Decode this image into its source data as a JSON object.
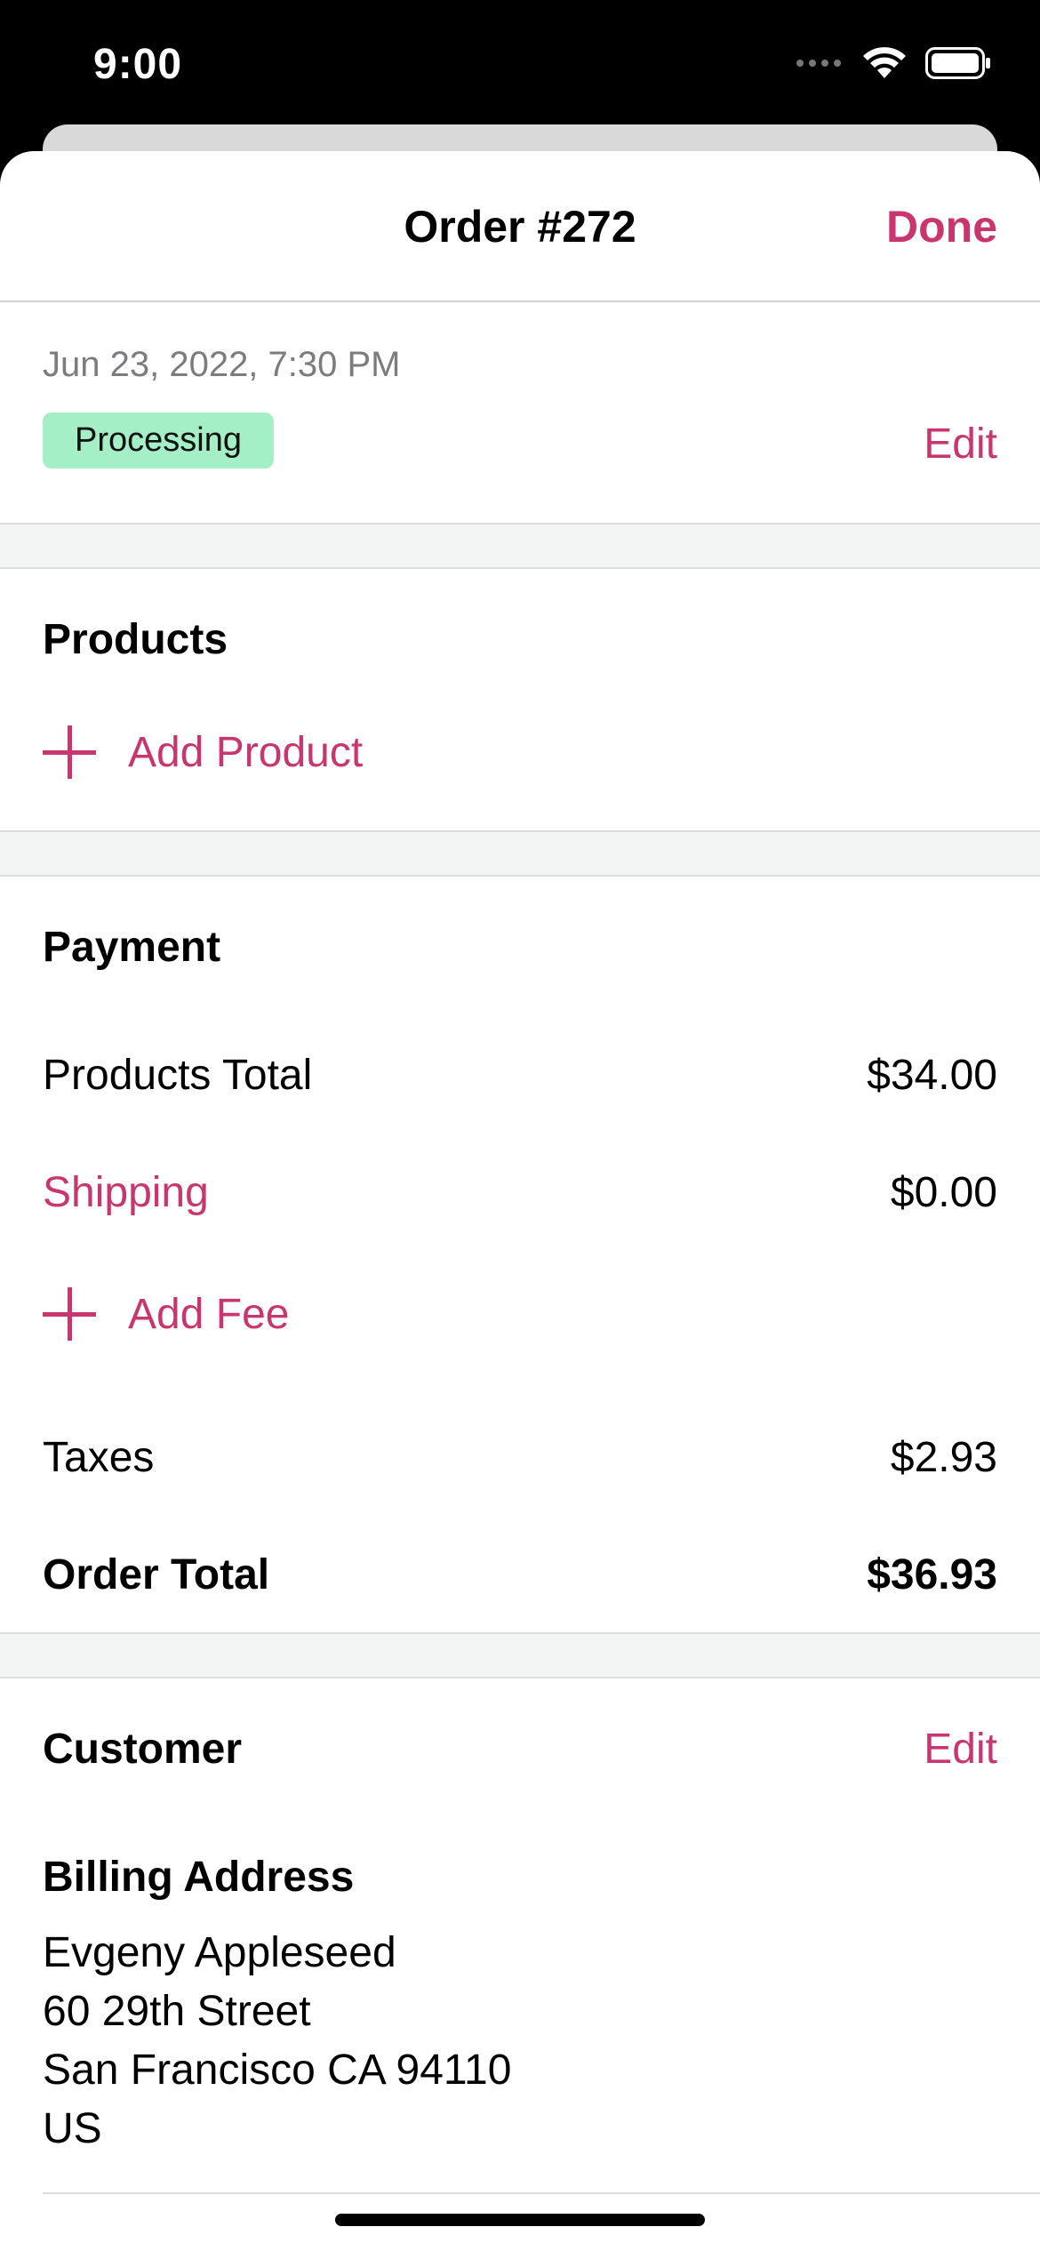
{
  "status_bar": {
    "time": "9:00"
  },
  "nav": {
    "title": "Order #272",
    "done": "Done"
  },
  "order": {
    "date": "Jun 23, 2022, 7:30 PM",
    "status": "Processing",
    "edit": "Edit"
  },
  "products": {
    "title": "Products",
    "add_product": "Add Product"
  },
  "payment": {
    "title": "Payment",
    "products_total_label": "Products Total",
    "products_total_value": "$34.00",
    "shipping_label": "Shipping",
    "shipping_value": "$0.00",
    "add_fee": "Add Fee",
    "taxes_label": "Taxes",
    "taxes_value": "$2.93",
    "order_total_label": "Order Total",
    "order_total_value": "$36.93"
  },
  "customer": {
    "title": "Customer",
    "edit": "Edit",
    "billing_title": "Billing Address",
    "billing_lines": [
      "Evgeny Appleseed",
      "60 29th Street",
      "San Francisco CA 94110",
      "US"
    ]
  },
  "colors": {
    "accent": "#c9356e",
    "badge_green": "#a5efc6"
  }
}
